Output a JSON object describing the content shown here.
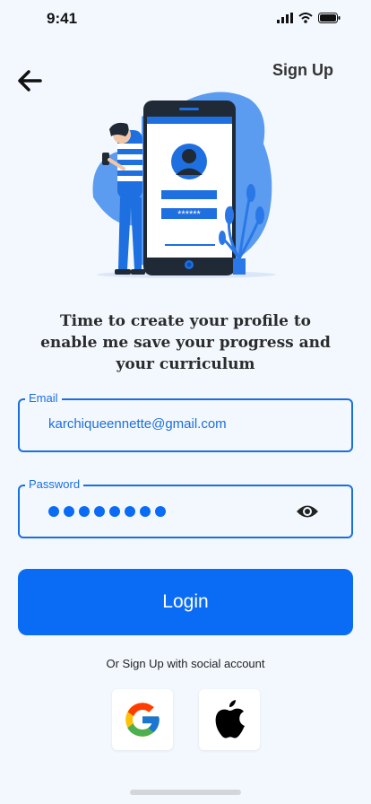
{
  "status_bar": {
    "time": "9:41"
  },
  "header": {
    "back_icon": "arrow-left-icon",
    "signup_label": "Sign Up"
  },
  "illustration": {
    "password_mask": "******"
  },
  "tagline": "Time to create your profile to enable me save your progress and your curriculum",
  "form": {
    "email": {
      "label": "Email",
      "value": "karchiqueennette@gmail.com"
    },
    "password": {
      "label": "Password",
      "masked_length": 8,
      "toggle_icon": "eye-icon"
    }
  },
  "login_button": {
    "label": "Login"
  },
  "social": {
    "caption": "Or Sign Up with social account",
    "providers": [
      "google-icon",
      "apple-icon"
    ]
  },
  "colors": {
    "primary": "#0a6cf5",
    "background": "#f3f8fe",
    "field_border": "#1a6fe0"
  }
}
